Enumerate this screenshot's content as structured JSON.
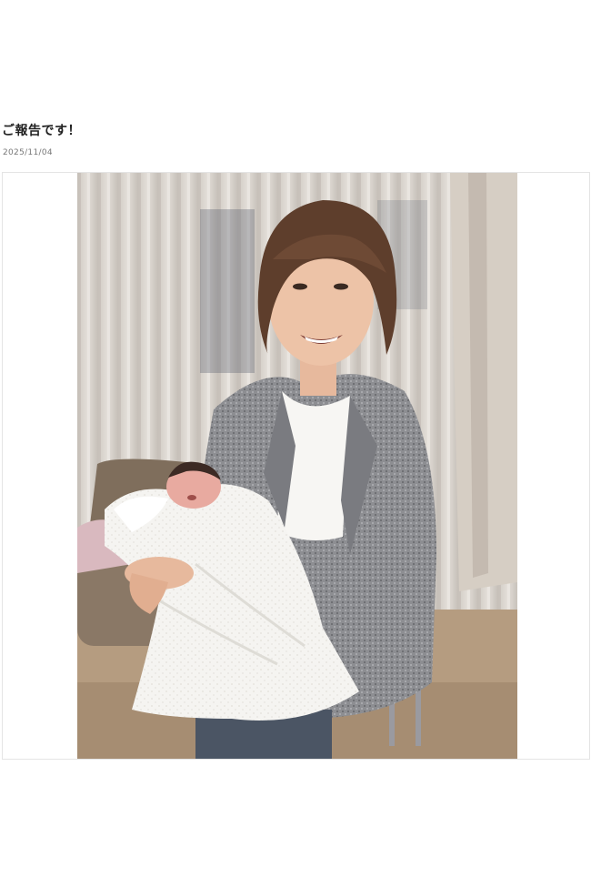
{
  "post": {
    "title": "ご報告です！",
    "date": "2025/11/04"
  },
  "photo": {
    "subject": "photo-man-holding-newborn",
    "colors": {
      "curtain": "#d9d4cf",
      "jacket": "#8e8f93",
      "towel": "#f4f3f0",
      "floor": "#b8a084"
    }
  }
}
